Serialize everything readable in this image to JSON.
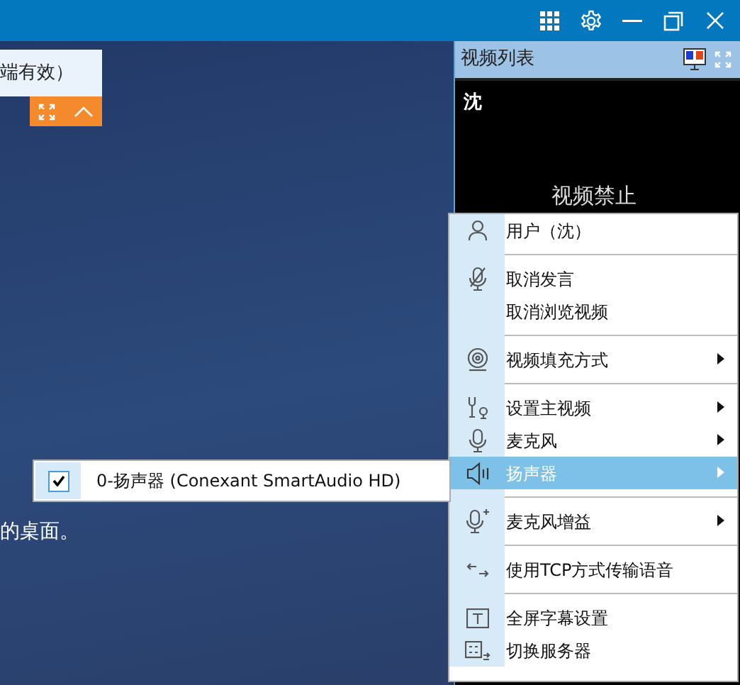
{
  "notice": {
    "text": "端有效）"
  },
  "desktop_text": "的桌面。",
  "video_list": {
    "title": "视频列表",
    "tiles": [
      {
        "name": "沈",
        "status": "视频禁止"
      }
    ]
  },
  "context_menu": {
    "items": [
      {
        "kind": "item",
        "label": "用户（沈）",
        "has_submenu": false,
        "selected": false
      },
      {
        "kind": "separator"
      },
      {
        "kind": "item",
        "label": "取消发言",
        "has_submenu": false,
        "selected": false
      },
      {
        "kind": "item",
        "label": "取消浏览视频",
        "has_submenu": false,
        "selected": false
      },
      {
        "kind": "separator"
      },
      {
        "kind": "item",
        "label": "视频填充方式",
        "has_submenu": true,
        "selected": false
      },
      {
        "kind": "separator"
      },
      {
        "kind": "item",
        "label": "设置主视频",
        "has_submenu": true,
        "selected": false
      },
      {
        "kind": "item",
        "label": "麦克风",
        "has_submenu": true,
        "selected": false
      },
      {
        "kind": "item",
        "label": "扬声器",
        "has_submenu": true,
        "selected": true
      },
      {
        "kind": "separator"
      },
      {
        "kind": "item",
        "label": "麦克风增益",
        "has_submenu": true,
        "selected": false
      },
      {
        "kind": "separator"
      },
      {
        "kind": "item",
        "label": "使用TCP方式传输语音",
        "has_submenu": false,
        "selected": false
      },
      {
        "kind": "separator"
      },
      {
        "kind": "item",
        "label": "全屏字幕设置",
        "has_submenu": false,
        "selected": false
      },
      {
        "kind": "item",
        "label": "切换服务器",
        "has_submenu": false,
        "selected": false
      }
    ]
  },
  "submenu": {
    "items": [
      {
        "label": "0-扬声器 (Conexant SmartAudio HD)",
        "checked": true
      }
    ]
  }
}
